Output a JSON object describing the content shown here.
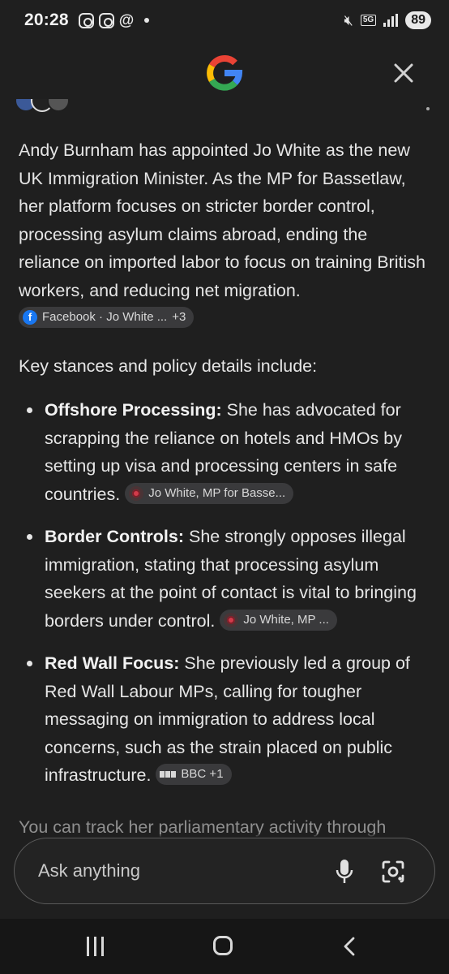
{
  "status_bar": {
    "time": "20:28",
    "network": "5G",
    "battery": "89"
  },
  "header": {
    "logo_icon": "google-g-icon",
    "close_icon": "close-icon"
  },
  "answer": {
    "intro": "Andy Burnham has appointed Jo White as the new UK Immigration Minister. As the MP for Bassetlaw, her platform focuses on stricter border control, processing asylum claims abroad, ending the reliance on imported labor to focus on training British workers, and reducing net migration.",
    "intro_source": {
      "label": "Facebook · Jo White ...",
      "more": "+3"
    },
    "subheading": "Key stances and policy details include:",
    "bullets": [
      {
        "title": "Offshore Processing:",
        "text": " She has advocated for scrapping the reliance on hotels and HMOs by setting up visa and processing centers in safe countries.",
        "source": "Jo White, MP for Basse..."
      },
      {
        "title": "Border Controls:",
        "text": " She strongly opposes illegal immigration, stating that processing asylum seekers at the point of contact is vital to bringing borders under control.",
        "source": "Jo White, MP ..."
      },
      {
        "title": "Red Wall Focus:",
        "text": " She previously led a group of Red Wall Labour MPs, calling for tougher messaging on immigration to address local concerns, such as the strain placed on public infrastructure.",
        "source": "BBC +1"
      }
    ],
    "trailing_text": "You can track her parliamentary activity through"
  },
  "ask_bar": {
    "placeholder": "Ask anything",
    "mic_icon": "microphone-icon",
    "lens_icon": "camera-search-icon"
  },
  "colors": {
    "background": "#1f1f1f",
    "chip": "#3a3a3c",
    "text": "#e6e6e6",
    "google_blue": "#4285F4",
    "google_red": "#EA4335",
    "google_yellow": "#FBBC05",
    "google_green": "#34A853"
  }
}
